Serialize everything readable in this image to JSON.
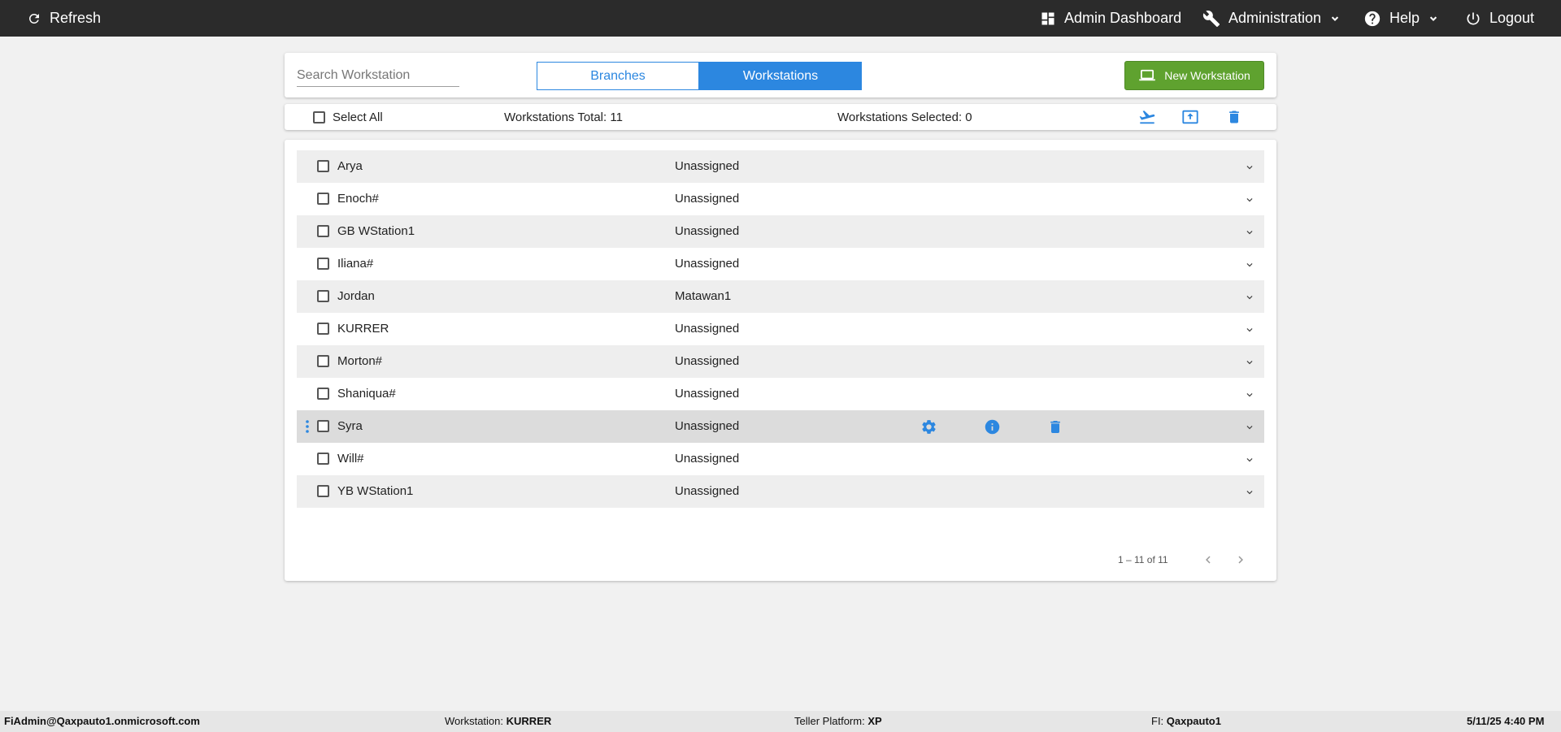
{
  "topbar": {
    "refresh_label": "Refresh",
    "admin_dashboard_label": "Admin Dashboard",
    "administration_label": "Administration",
    "help_label": "Help",
    "logout_label": "Logout"
  },
  "toolbar": {
    "search_placeholder": "Search Workstation",
    "tabs": [
      {
        "label": "Branches",
        "active": false
      },
      {
        "label": "Workstations",
        "active": true
      }
    ],
    "new_button_label": "New Workstation"
  },
  "summary": {
    "select_all_label": "Select All",
    "total_text": "Workstations Total: 11",
    "selected_text": "Workstations Selected: 0"
  },
  "workstations": [
    {
      "name": "Arya",
      "branch": "Unassigned"
    },
    {
      "name": "Enoch#",
      "branch": "Unassigned"
    },
    {
      "name": "GB WStation1",
      "branch": "Unassigned"
    },
    {
      "name": "Iliana#",
      "branch": "Unassigned"
    },
    {
      "name": "Jordan",
      "branch": "Matawan1"
    },
    {
      "name": "KURRER",
      "branch": "Unassigned"
    },
    {
      "name": "Morton#",
      "branch": "Unassigned"
    },
    {
      "name": "Shaniqua#",
      "branch": "Unassigned"
    },
    {
      "name": "Syra",
      "branch": "Unassigned"
    },
    {
      "name": "Will#",
      "branch": "Unassigned"
    },
    {
      "name": "YB WStation1",
      "branch": "Unassigned"
    }
  ],
  "pager": {
    "range_text": "1 – 11 of 11"
  },
  "statusbar": {
    "user": "FiAdmin@Qaxpauto1.onmicrosoft.com",
    "workstation_label": "Workstation:",
    "workstation_value": "KURRER",
    "platform_label": "Teller Platform:",
    "platform_value": "XP",
    "fi_label": "FI:",
    "fi_value": "Qaxpauto1",
    "datetime": "5/11/25 4:40 PM"
  },
  "colors": {
    "accent": "#2c87e0",
    "new_button": "#5fa22f",
    "topbar": "#2b2b2b"
  }
}
